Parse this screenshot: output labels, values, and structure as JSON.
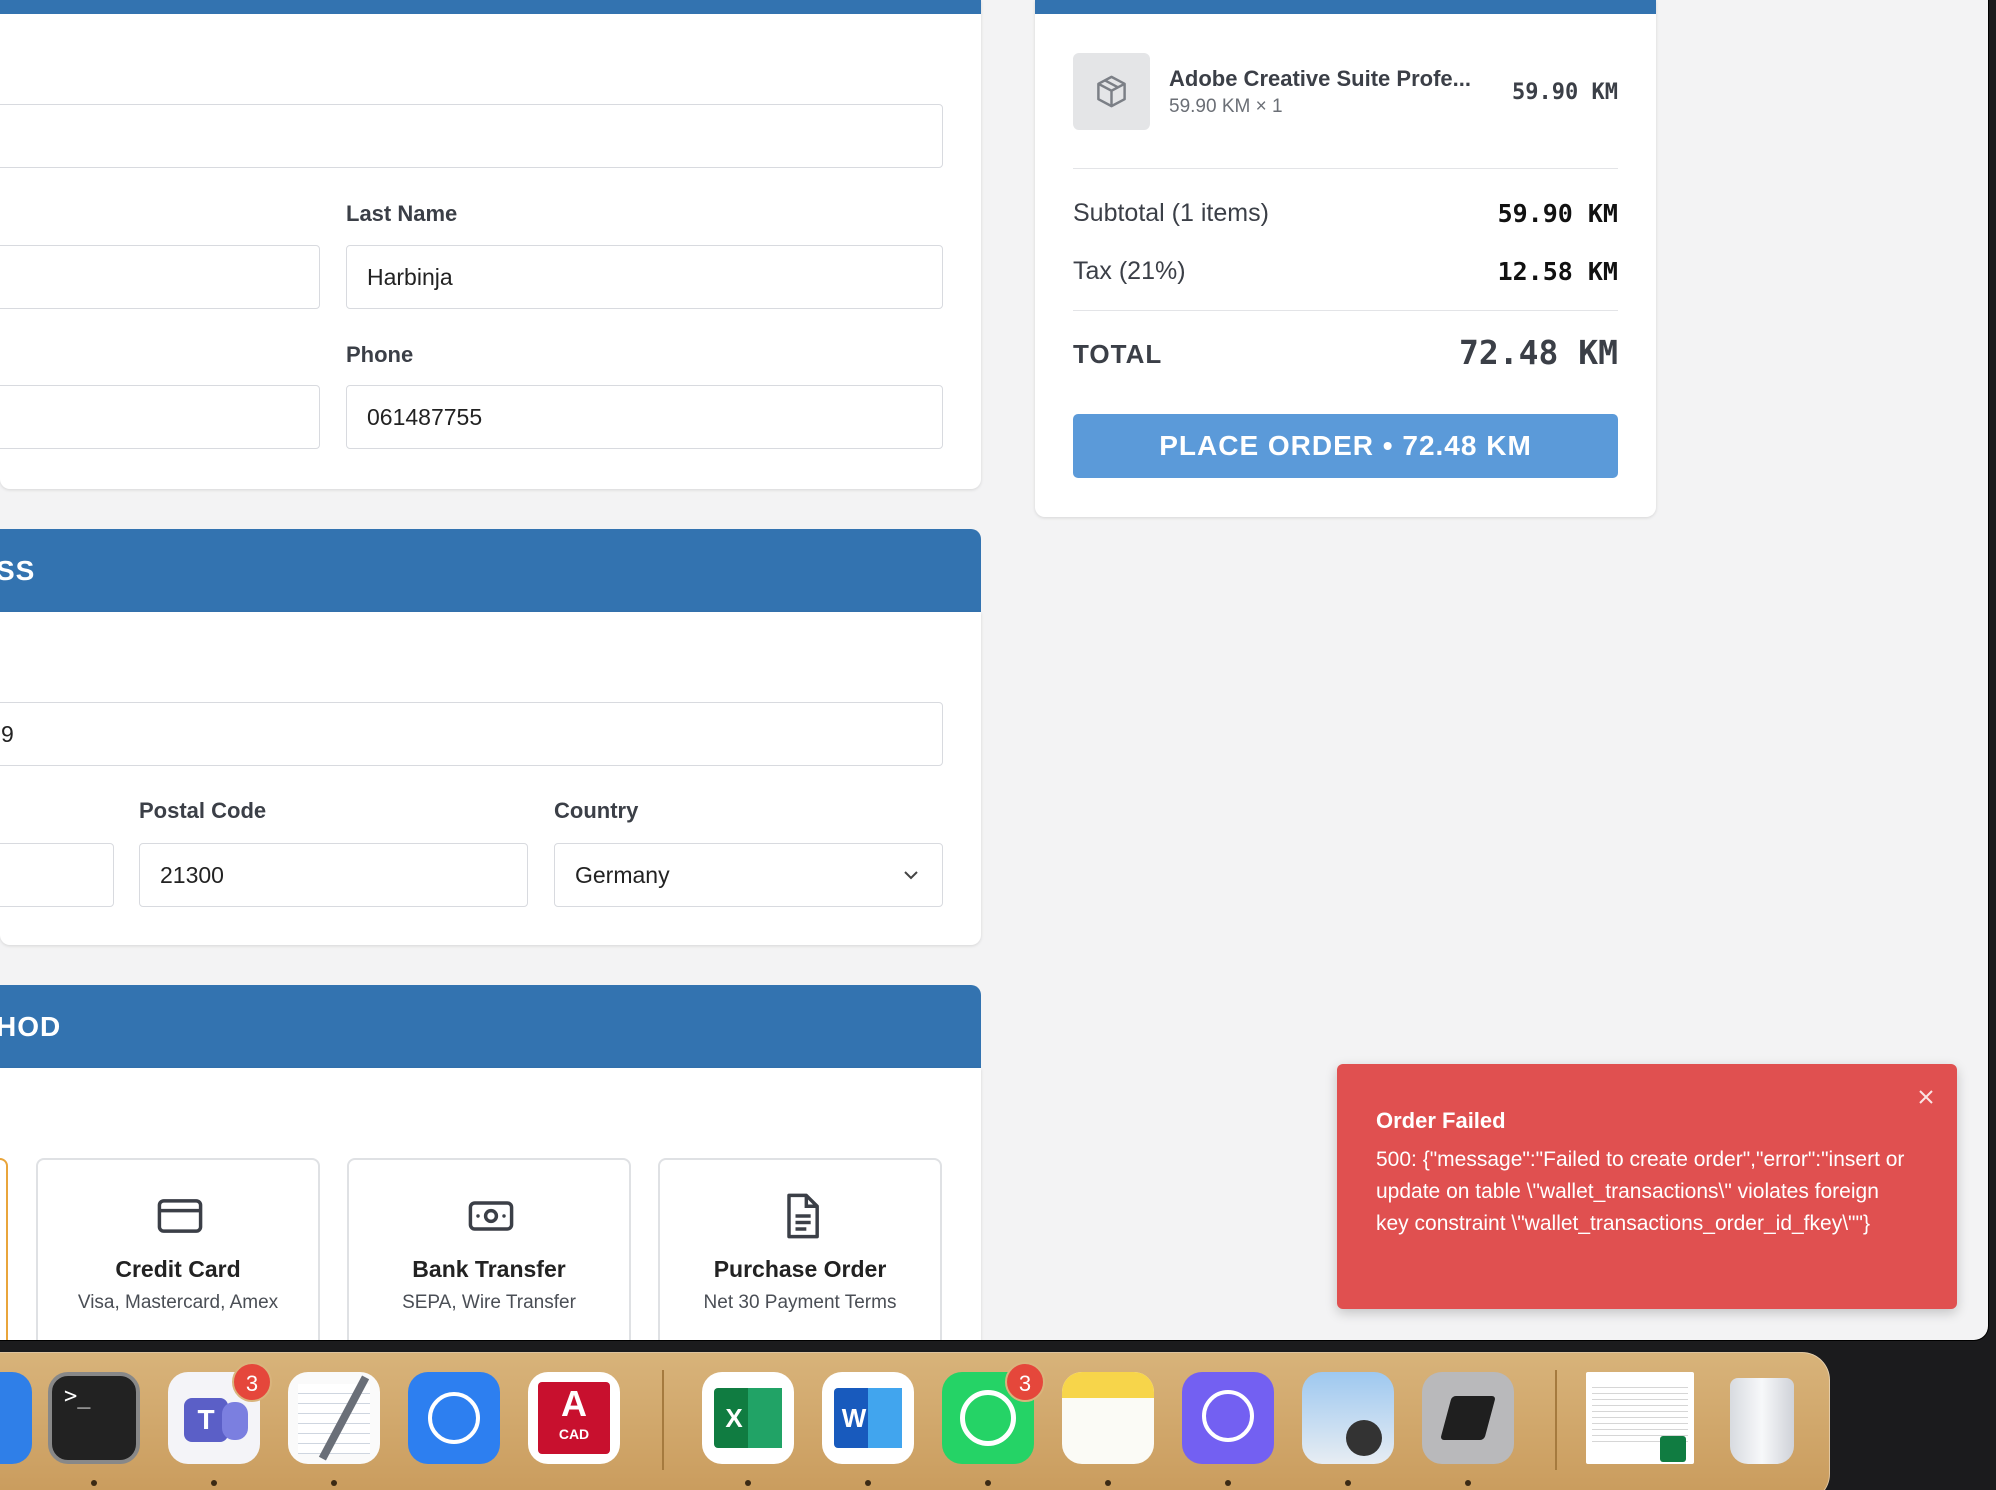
{
  "contact": {
    "last_name_label": "Last Name",
    "last_name_value": "Harbinja",
    "phone_label": "Phone",
    "phone_value": "061487755"
  },
  "address": {
    "header": "SS",
    "street_value": "9",
    "postal_label": "Postal Code",
    "postal_value": "21300",
    "country_label": "Country",
    "country_value": "Germany"
  },
  "payment": {
    "header": "HOD",
    "options": [
      {
        "title": "Credit Card",
        "sub": "Visa, Mastercard, Amex",
        "icon": "credit-card-icon"
      },
      {
        "title": "Bank Transfer",
        "sub": "SEPA, Wire Transfer",
        "icon": "banknote-icon"
      },
      {
        "title": "Purchase Order",
        "sub": "Net 30 Payment Terms",
        "icon": "document-icon"
      }
    ]
  },
  "summary": {
    "item_name": "Adobe Creative Suite Profe...",
    "item_qty": "59.90 KM × 1",
    "item_price": "59.90 KM",
    "subtotal_label": "Subtotal (1 items)",
    "subtotal_value": "59.90 KM",
    "tax_label": "Tax (21%)",
    "tax_value": "12.58 KM",
    "total_label": "TOTAL",
    "total_value": "72.48 KM",
    "place_order": "PLACE ORDER • 72.48 KM"
  },
  "toast": {
    "title": "Order Failed",
    "message": "500: {\"message\":\"Failed to create order\",\"error\":\"insert or update on table \\\"wallet_transactions\\\" violates foreign key constraint \\\"wallet_transactions_order_id_fkey\\\"\"}"
  },
  "dock": {
    "badges": {
      "teams": "3",
      "whatsapp": "3"
    },
    "apps": [
      "finder",
      "terminal",
      "teams",
      "textedit",
      "safari-like",
      "autocad",
      "excel",
      "word",
      "whatsapp",
      "notes",
      "viber",
      "preview",
      "cursor",
      "excel-document",
      "trash"
    ],
    "autocad_text": "CAD"
  },
  "colors": {
    "header_blue": "#3373b0",
    "button_blue": "#5b9ad9",
    "toast_red": "#e05050"
  }
}
